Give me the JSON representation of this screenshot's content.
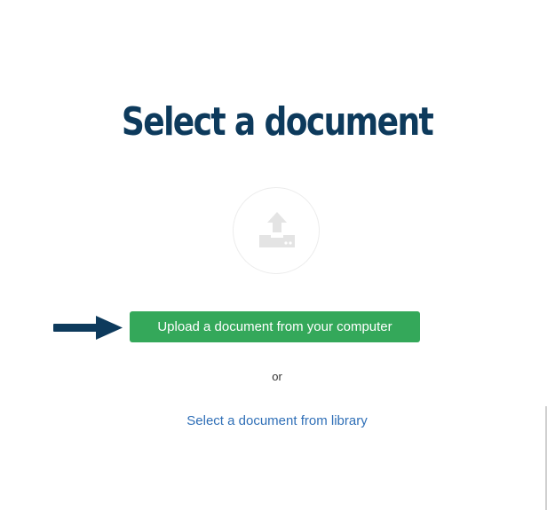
{
  "page": {
    "title": "Select a document",
    "upload_icon": "upload-tray-icon",
    "upload_button_label": "Upload a document from your computer",
    "separator_text": "or",
    "library_link_label": "Select a document from library"
  },
  "annotation": {
    "pointer_icon": "arrow-right-icon"
  },
  "colors": {
    "title": "#0d3a5c",
    "upload_button": "#34a85a",
    "link": "#2f6fb7",
    "arrow": "#0d3a5c",
    "icon": "#e4e4e4"
  }
}
